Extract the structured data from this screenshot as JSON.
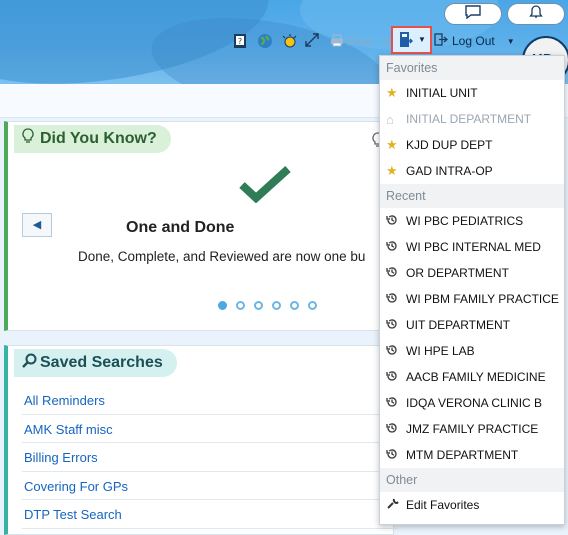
{
  "header": {
    "print_label": "Print",
    "logout_label": "Log Out",
    "avatar_initials": "KD",
    "accent_color": "#4aa6e6"
  },
  "did_you_know": {
    "title": "Did You Know?",
    "heading": "One and Done",
    "body": "Done, Complete, and Reviewed are now one bu",
    "dots_total": 6,
    "active_dot": 1
  },
  "saved_searches": {
    "title": "Saved Searches",
    "items": [
      "All Reminders",
      "AMK Staff misc",
      "Billing Errors",
      "Covering For GPs",
      "DTP Test Search"
    ]
  },
  "menu": {
    "favorites_header": "Favorites",
    "favorites": [
      {
        "label": "INITIAL UNIT",
        "icon": "star-icon"
      },
      {
        "label": "INITIAL DEPARTMENT",
        "icon": "home-icon",
        "disabled": true
      },
      {
        "label": "KJD DUP DEPT",
        "icon": "star-icon"
      },
      {
        "label": "GAD INTRA-OP",
        "icon": "star-icon"
      }
    ],
    "recent_header": "Recent",
    "recent": [
      "WI PBC PEDIATRICS",
      "WI PBC INTERNAL MED",
      "OR DEPARTMENT",
      "WI PBM FAMILY PRACTICE",
      "UIT DEPARTMENT",
      "WI HPE LAB",
      "AACB FAMILY MEDICINE",
      "IDQA VERONA CLINIC B",
      "JMZ FAMILY PRACTICE",
      "MTM DEPARTMENT"
    ],
    "other_header": "Other",
    "edit_favorites": "Edit Favorites"
  }
}
